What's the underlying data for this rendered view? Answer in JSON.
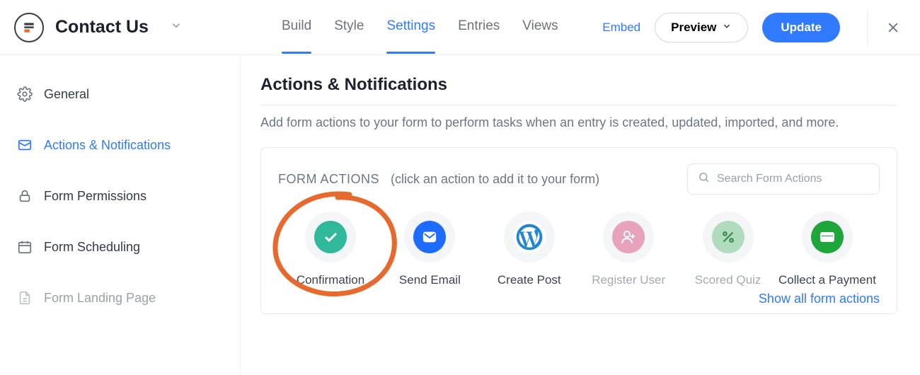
{
  "header": {
    "form_title": "Contact Us",
    "tabs": {
      "build": "Build",
      "style": "Style",
      "settings": "Settings",
      "entries": "Entries",
      "views": "Views"
    },
    "embed": "Embed",
    "preview": "Preview",
    "update": "Update"
  },
  "sidebar": {
    "general": "General",
    "actions": "Actions & Notifications",
    "permissions": "Form Permissions",
    "scheduling": "Form Scheduling",
    "landing": "Form Landing Page"
  },
  "main": {
    "title": "Actions & Notifications",
    "subtitle": "Add form actions to your form to perform tasks when an entry is created, updated, imported, and more.",
    "form_actions_label": "FORM ACTIONS",
    "form_actions_hint": "(click an action to add it to your form)",
    "search_placeholder": "Search Form Actions",
    "actions": {
      "confirmation": "Confirmation",
      "send_email": "Send Email",
      "create_post": "Create Post",
      "register_user": "Register User",
      "scored_quiz": "Scored Quiz",
      "collect_payment": "Collect a Payment"
    },
    "show_all": "Show all form actions"
  }
}
